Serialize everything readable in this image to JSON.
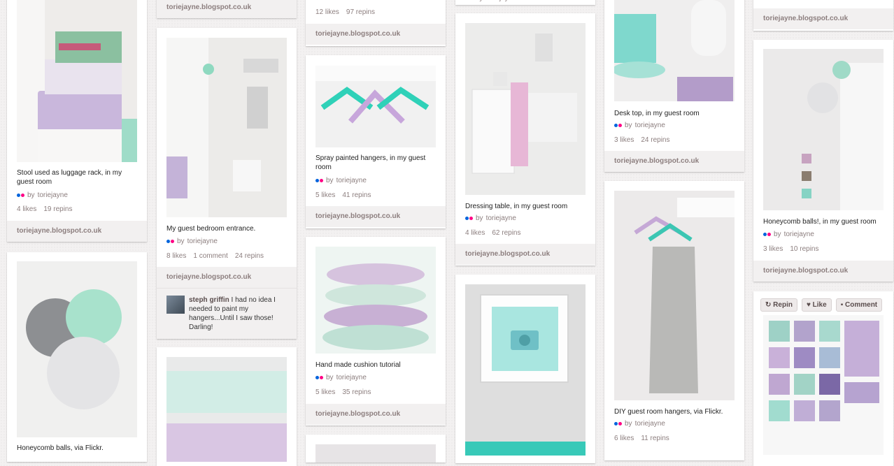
{
  "pins": [
    {
      "id": "stool",
      "desc": "Stool used as luggage rack, in my guest room",
      "by": "by",
      "user": "toriejayne",
      "likes": "4 likes",
      "repins": "19 repins",
      "source": "toriejayne.blogspot.co.uk"
    },
    {
      "id": "honeycomb1",
      "desc": "Honeycomb balls, via Flickr."
    },
    {
      "id": "col2top",
      "source": "toriejayne.blogspot.co.uk"
    },
    {
      "id": "entrance",
      "desc": "My guest bedroom entrance.",
      "by": "by",
      "user": "toriejayne",
      "likes": "8 likes",
      "comments": "1 comment",
      "repins": "24 repins",
      "source": "toriejayne.blogspot.co.uk",
      "comment": {
        "name": "steph griffin",
        "text": " I had no idea I needed to paint my hangers...Until I saw those! Darling!"
      }
    },
    {
      "id": "pillow2"
    },
    {
      "id": "col3top",
      "likes": "12 likes",
      "repins": "97 repins",
      "source": "toriejayne.blogspot.co.uk"
    },
    {
      "id": "hangers",
      "desc": "Spray painted hangers, in my guest room",
      "by": "by",
      "user": "toriejayne",
      "likes": "5 likes",
      "repins": "41 repins",
      "source": "toriejayne.blogspot.co.uk"
    },
    {
      "id": "cushion",
      "desc": "Hand made cushion tutorial",
      "by": "by",
      "user": "toriejayne",
      "likes": "5 likes",
      "repins": "35 repins",
      "source": "toriejayne.blogspot.co.uk"
    },
    {
      "id": "col3bottom"
    },
    {
      "id": "col4top",
      "by": "by",
      "user": "toriejayne"
    },
    {
      "id": "dressing",
      "desc": "Dressing table, in my guest room",
      "by": "by",
      "user": "toriejayne",
      "likes": "4 likes",
      "repins": "62 repins",
      "source": "toriejayne.blogspot.co.uk"
    },
    {
      "id": "frame"
    },
    {
      "id": "desk",
      "desc": "Desk top, in my guest room",
      "by": "by",
      "user": "toriejayne",
      "likes": "3 likes",
      "repins": "24 repins",
      "source": "toriejayne.blogspot.co.uk"
    },
    {
      "id": "diyhangers",
      "desc": "DIY guest room hangers, via Flickr.",
      "by": "by",
      "user": "toriejayne",
      "likes": "6 likes",
      "repins": "11 repins"
    },
    {
      "id": "col6top",
      "source": "toriejayne.blogspot.co.uk"
    },
    {
      "id": "honeycomb2",
      "desc": "Honeycomb balls!, in my guest room",
      "by": "by",
      "user": "toriejayne",
      "likes": "3 likes",
      "repins": "10 repins",
      "source": "toriejayne.blogspot.co.uk"
    },
    {
      "id": "shelf",
      "actions": {
        "repin": "Repin",
        "like": "Like",
        "comment": "Comment"
      }
    }
  ]
}
